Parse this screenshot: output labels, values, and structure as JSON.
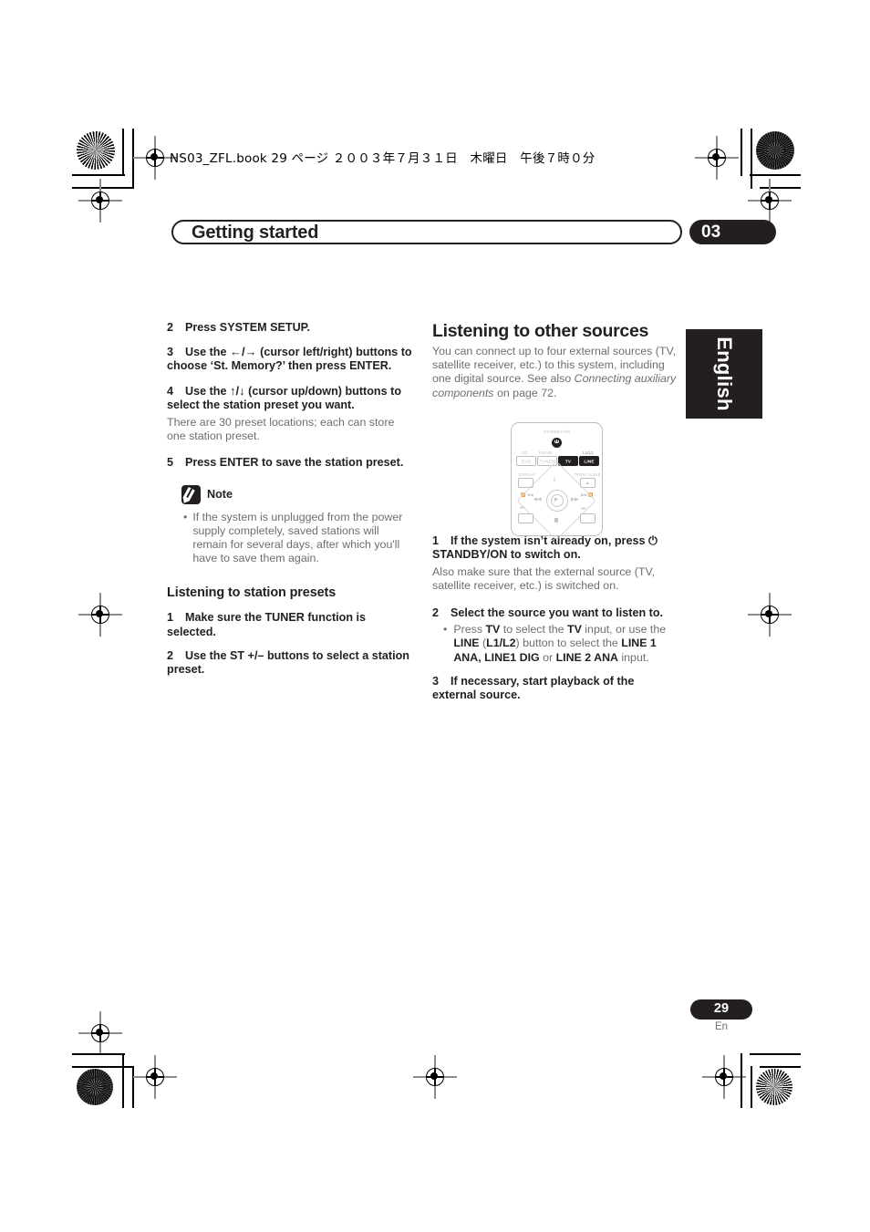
{
  "print_header": {
    "book_line": "NS03_ZFL.book  29 ページ  ２００３年７月３１日　木曜日　午後７時０分"
  },
  "banner": {
    "title": "Getting started",
    "chapter": "03"
  },
  "side_tab": {
    "language": "English"
  },
  "left_column": {
    "steps": [
      {
        "num": "2",
        "text": "Press SYSTEM SETUP."
      },
      {
        "num": "3",
        "text_before": "Use the ",
        "arrows": "←/→",
        "text_after": " (cursor left/right) buttons to choose ‘St. Memory?’ then press ENTER."
      },
      {
        "num": "4",
        "text_before": "Use the ",
        "arrows": "↑/↓",
        "text_after": " (cursor up/down) buttons to select the station preset you want."
      },
      {
        "num": "5",
        "text": "Press ENTER to save the station preset."
      }
    ],
    "step4_body": "There are 30 preset locations; each can store one station preset.",
    "note": {
      "label": "Note",
      "bullet": "•",
      "text": "If the system is unplugged from the power supply completely, saved stations will remain for several days, after which you'll have to save them again."
    },
    "section": {
      "heading": "Listening to station presets",
      "steps": [
        {
          "num": "1",
          "text": "Make sure the TUNER function is selected."
        },
        {
          "num": "2",
          "text": "Use the ST +/– buttons to select a station preset."
        }
      ]
    }
  },
  "right_column": {
    "heading": "Listening to other sources",
    "intro_1": "You can connect up to four external sources (TV, satellite receiver, etc.) to this system, including one digital source. See also ",
    "intro_italic": "Connecting auxiliary components",
    "intro_2": " on page 72.",
    "steps": [
      {
        "num": "1",
        "text_before": "If the system isn’t already on, press ",
        "symbol": "⏻",
        "text_after": " STANDBY/ON to switch on."
      },
      {
        "num": "2",
        "text": "Select the source you want to listen to."
      },
      {
        "num": "3",
        "text": "If necessary, start playback of the external source."
      }
    ],
    "step1_body": "Also make sure that the external source (TV, satellite receiver, etc.) is switched on.",
    "step2_bullet": {
      "bullet": "•",
      "p1": "Press ",
      "b1": "TV",
      "p2": " to select the ",
      "b2": "TV",
      "p3": " input, or use the ",
      "b3": "LINE",
      "p4": " (",
      "b4": "L1/L2",
      "p5": ") button to select the ",
      "b5": "LINE 1 ANA, LINE1 DIG",
      "p6": " or ",
      "b6": "LINE 2 ANA",
      "p7": " input."
    }
  },
  "remote": {
    "standby_label": "STANDBY/ON",
    "row_top_labels": [
      "CD",
      "FM/AM",
      "L1/L2"
    ],
    "row_buttons": [
      {
        "label": "DVD",
        "active": false
      },
      {
        "label": "TUNER",
        "active": false
      },
      {
        "label": "TV",
        "active": true
      },
      {
        "label": "LINE",
        "active": true
      }
    ],
    "display_label": "DISPLAY",
    "open_close_label": "OPEN CLOSE",
    "left_small_label": "⏪/◀◀",
    "right_small_label": "▶▶/⏩",
    "glyphs": {
      "pause": "‖",
      "eject": "▲",
      "rew": "◀◀",
      "ffwd": "▶▶",
      "play": "▶",
      "prev": "⏮",
      "next": "⏭",
      "stop": "■"
    }
  },
  "footer": {
    "page_number": "29",
    "page_suffix": "En"
  },
  "colors": {
    "ink": "#231f20",
    "gray_text": "#6d6e71",
    "remote_outline": "#bcbec0"
  }
}
